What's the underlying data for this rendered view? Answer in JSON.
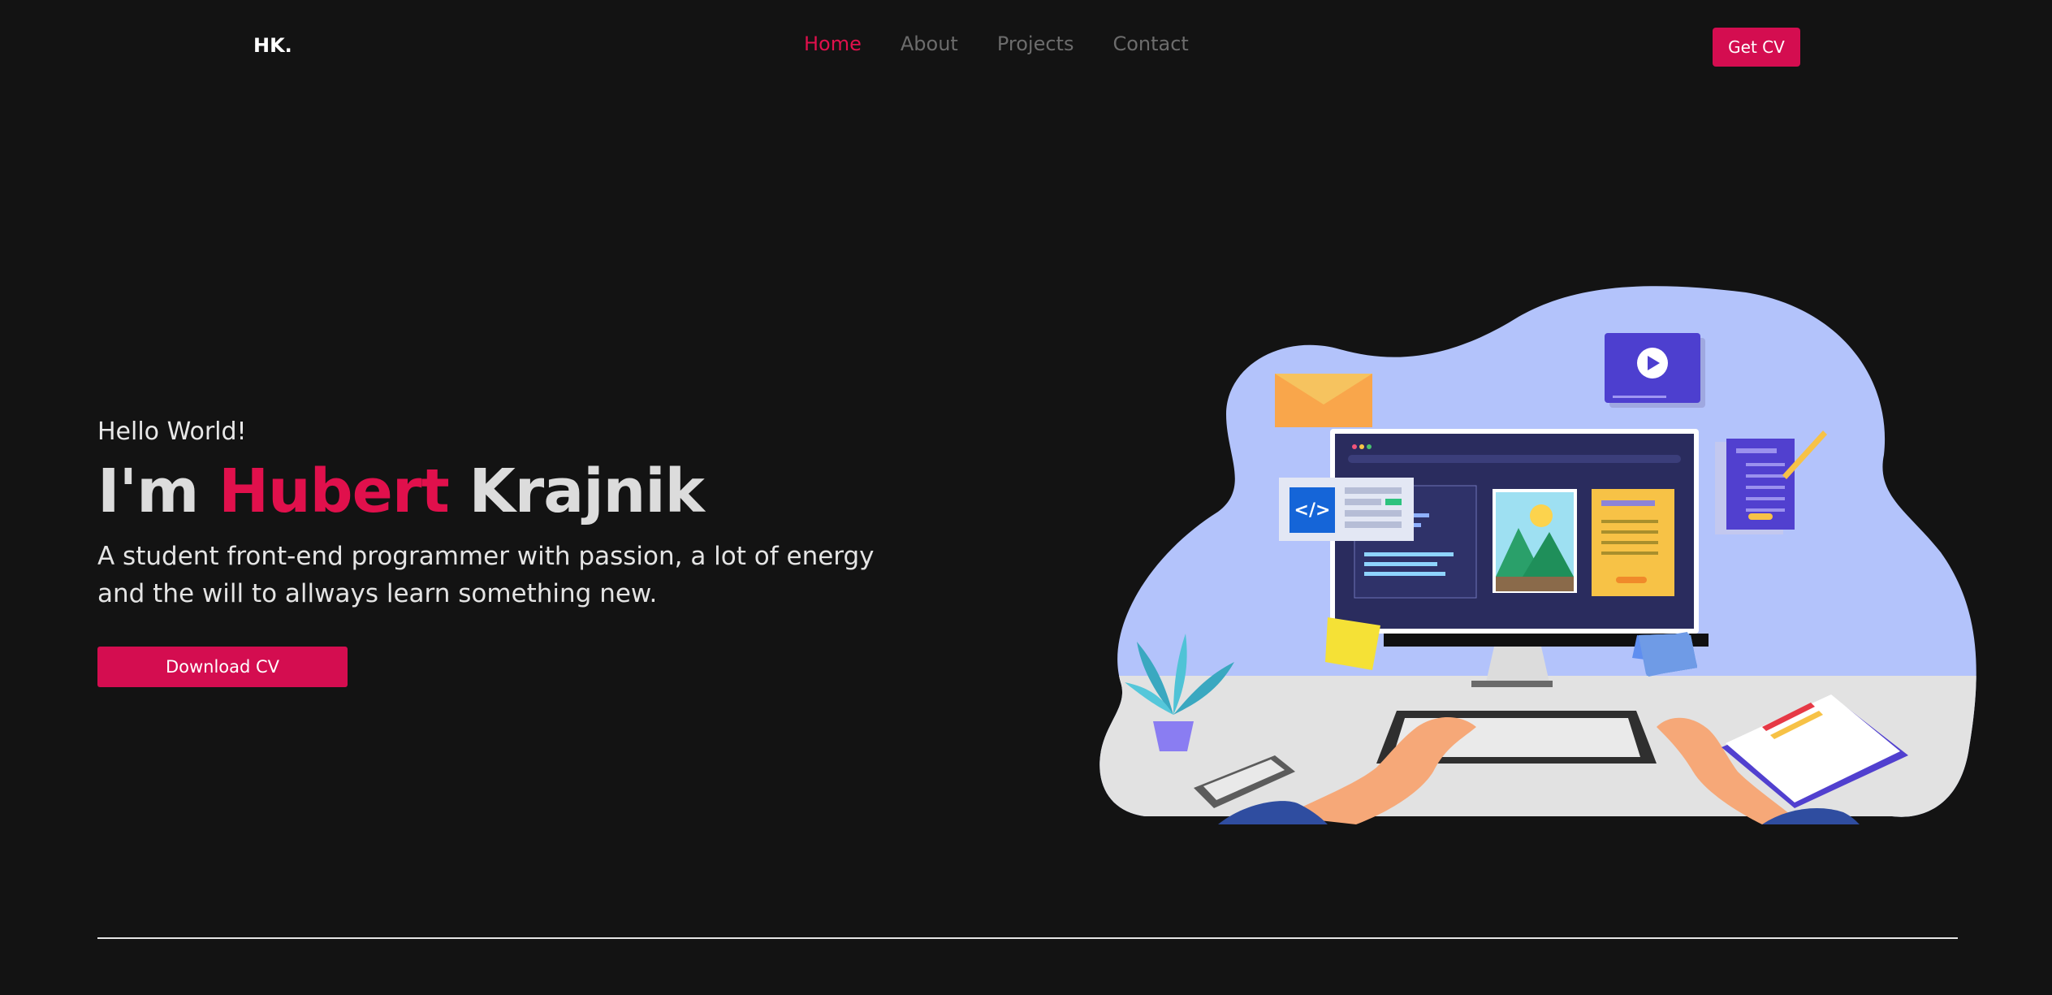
{
  "brand": {
    "logo": "HK."
  },
  "nav": {
    "items": [
      {
        "label": "Home",
        "active": true
      },
      {
        "label": "About",
        "active": false
      },
      {
        "label": "Projects",
        "active": false
      },
      {
        "label": "Contact",
        "active": false
      }
    ],
    "cta_label": "Get CV"
  },
  "hero": {
    "greeting": "Hello World!",
    "title_prefix": "I'm ",
    "title_highlight": "Hubert",
    "title_suffix": " Krajnik",
    "description": "A student front-end programmer with passion, a lot of energy and the will to allways learn something new.",
    "button_label": "Download CV"
  },
  "illustration": {
    "code_tag": "</>"
  },
  "colors": {
    "accent": "#d40d50",
    "accent_text": "#e0104c",
    "background": "#131313",
    "blob": "#b3c3fb",
    "desk": "#e2e2e2"
  }
}
